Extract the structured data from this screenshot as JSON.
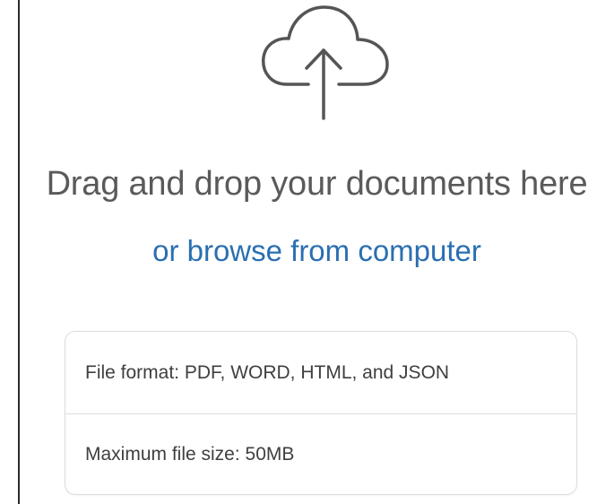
{
  "upload": {
    "icon": "cloud-upload-icon",
    "title": "Drag and drop your documents here",
    "browse_label": "or browse from computer"
  },
  "info": {
    "file_format": "File format: PDF, WORD, HTML, and JSON",
    "max_size": "Maximum file size: 50MB"
  },
  "colors": {
    "title": "#5a5a5a",
    "link": "#2a6fb0",
    "icon": "#555555",
    "border": "#dcdcdc"
  }
}
